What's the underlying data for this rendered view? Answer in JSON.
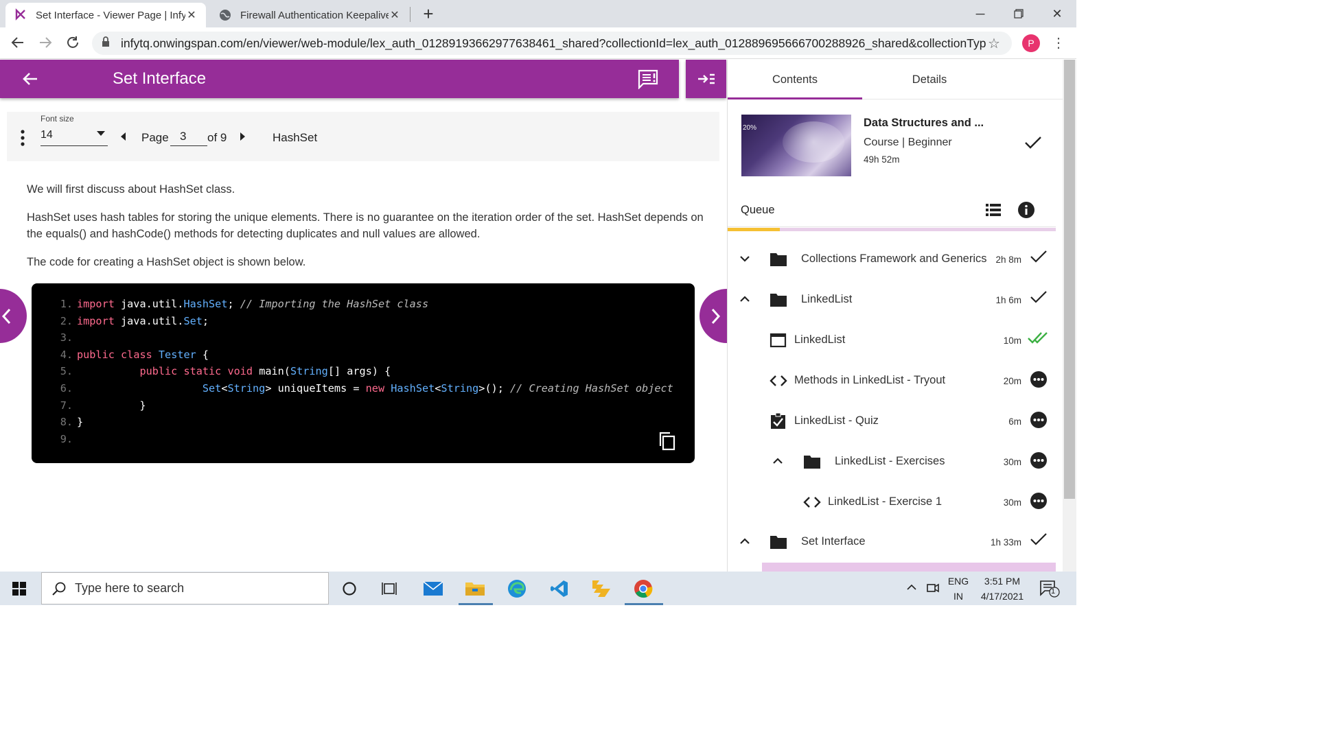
{
  "browser": {
    "tabs": [
      {
        "title": "Set Interface - Viewer Page | Infy",
        "active": true
      },
      {
        "title": "Firewall Authentication Keepalive",
        "active": false
      }
    ],
    "url": "infytq.onwingspan.com/en/viewer/web-module/lex_auth_01289193662977638461_shared?collectionId=lex_auth_01288969566670028892​6_shared&collectionType...",
    "profile_initial": "P"
  },
  "header": {
    "title": "Set Interface"
  },
  "viewer": {
    "font_size_label": "Font size",
    "font_size_value": "14",
    "page_label": "Page",
    "page_current": "3",
    "page_total": "of 9",
    "section_title": "HashSet"
  },
  "content": {
    "paragraphs": [
      "We will first discuss about HashSet class.",
      "HashSet uses hash tables for storing the unique elements. There is no guarantee on the iteration order of the set. HashSet depends on the equals() and hashCode() methods for detecting duplicates and null values are allowed.",
      "The code for creating a HashSet object is shown below."
    ],
    "code_lines": [
      "1.",
      "2.",
      "3.",
      "4.",
      "5.",
      "6.",
      "7.",
      "8.",
      "9."
    ]
  },
  "panel": {
    "tab_contents": "Contents",
    "tab_details": "Details",
    "course_title": "Data Structures and ...",
    "course_type": "Course |",
    "course_level": "Beginner",
    "course_duration": "49h 52m",
    "course_progress": 0.16,
    "queue_label": "Queue",
    "items": [
      {
        "name": "Collections Framework and Generics",
        "dur": "2h 8m"
      },
      {
        "name": "LinkedList",
        "dur": "1h 6m"
      },
      {
        "name": "LinkedList",
        "dur": "10m"
      },
      {
        "name": "Methods in LinkedList - Tryout",
        "dur": "20m"
      },
      {
        "name": "LinkedList - Quiz",
        "dur": "6m"
      },
      {
        "name": "LinkedList - Exercises",
        "dur": "30m"
      },
      {
        "name": "LinkedList - Exercise 1",
        "dur": "30m"
      },
      {
        "name": "Set Interface",
        "dur": "1h 33m"
      }
    ]
  },
  "taskbar": {
    "search_placeholder": "Type here to search",
    "lang_top": "ENG",
    "lang_bottom": "IN",
    "time": "3:51 PM",
    "date": "4/17/2021",
    "notif_count": "1"
  },
  "colors": {
    "brand": "#962d98",
    "progress": "#f5c033",
    "done_check": "#3cb043"
  }
}
